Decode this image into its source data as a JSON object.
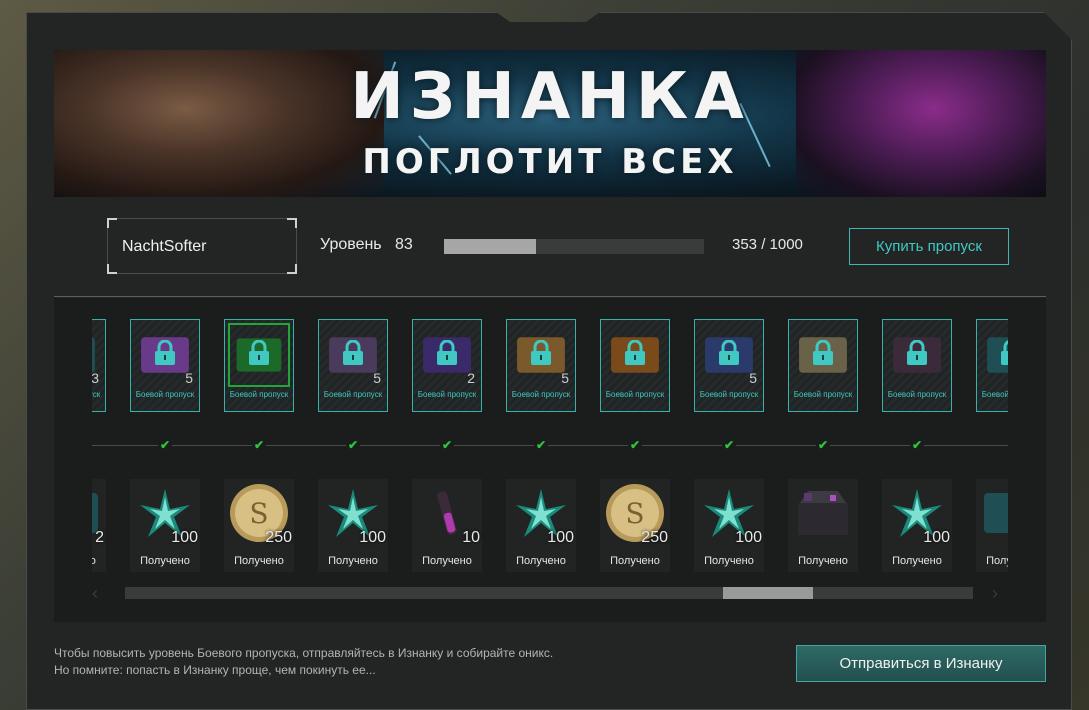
{
  "banner": {
    "line1": "ИЗНАНКА",
    "line2": "ПОГЛОТИТ ВСЕХ"
  },
  "player": {
    "name": "NachtSofter"
  },
  "level": {
    "label": "Уровень",
    "value": "83",
    "xp_current": 353,
    "xp_max": 1000,
    "xp_text": "353 / 1000"
  },
  "buttons": {
    "buy_pass": "Купить пропуск",
    "go": "Отправиться в Изнанку"
  },
  "premium_caption": "Боевой пропуск",
  "premium_items": [
    {
      "qty": "3",
      "icon": "crate-icon",
      "color": "#1f4f54"
    },
    {
      "qty": "5",
      "icon": "purple-case-icon",
      "color": "#6a3a8a"
    },
    {
      "qty": "",
      "icon": "green-skin-icon",
      "color": "#1c6a2a",
      "selected": true
    },
    {
      "qty": "5",
      "icon": "weapon-purple-icon",
      "color": "#4a3a5c"
    },
    {
      "qty": "2",
      "icon": "purple-vial-icon",
      "color": "#3a2a6a"
    },
    {
      "qty": "5",
      "icon": "winged-badge-icon",
      "color": "#7a5a2a"
    },
    {
      "qty": "",
      "icon": "orange-vial-icon",
      "color": "#7a4a1a"
    },
    {
      "qty": "5",
      "icon": "weapon-blue-icon",
      "color": "#2a3a6a"
    },
    {
      "qty": "",
      "icon": "camo-target-icon",
      "color": "#6a6248"
    },
    {
      "qty": "",
      "icon": "dark-crystal-case-icon",
      "color": "#3a2a3a"
    },
    {
      "qty": "",
      "icon": "crate-icon",
      "color": "#1f4f54"
    }
  ],
  "free_status": "Получено",
  "free_items": [
    {
      "qty": "2",
      "icon": "crate-icon",
      "color": "#1f4f54"
    },
    {
      "qty": "100",
      "icon": "onyx-crystal-icon",
      "color": "#1a8a7a"
    },
    {
      "qty": "250",
      "icon": "gold-coin-icon",
      "color": "#b89a5a"
    },
    {
      "qty": "100",
      "icon": "onyx-crystal-icon",
      "color": "#1a8a7a"
    },
    {
      "qty": "10",
      "icon": "pink-vial-icon",
      "color": "#b03ab0"
    },
    {
      "qty": "100",
      "icon": "onyx-crystal-icon",
      "color": "#1a8a7a"
    },
    {
      "qty": "250",
      "icon": "gold-coin-icon",
      "color": "#b89a5a"
    },
    {
      "qty": "100",
      "icon": "onyx-crystal-icon",
      "color": "#1a8a7a"
    },
    {
      "qty": "",
      "icon": "crystal-chest-icon",
      "color": "#5a3a6a"
    },
    {
      "qty": "100",
      "icon": "onyx-crystal-icon",
      "color": "#1a8a7a"
    },
    {
      "qty": "",
      "icon": "crate-icon",
      "color": "#1f4f54"
    }
  ],
  "scroll": {
    "position": 0.789,
    "thumb_fraction": 0.106
  },
  "hint": {
    "line1": "Чтобы повысить уровень Боевого пропуска, отправляйтесь в Изнанку и собирайте оникс.",
    "line2": "Но помните: попасть в Изнанку проще, чем покинуть ее..."
  }
}
